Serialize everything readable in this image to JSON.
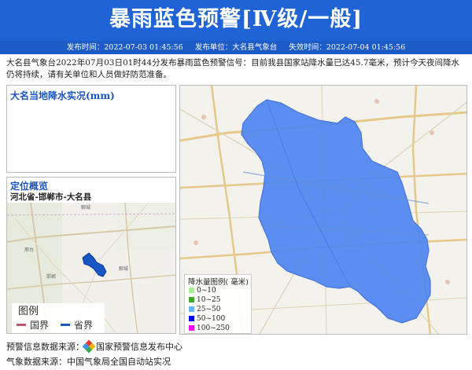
{
  "header": {
    "title": "暴雨蓝色预警[Ⅳ级/一般]",
    "publish_time": "发布时间：2022-07-03 01:45:56",
    "publisher": "发布单位：大名县气象台",
    "expire_time": "失效时间：2022-07-04 01:45:56"
  },
  "description": "大名县气象台2022年07月03日01时44分发布暴雨蓝色预警信号：目前我县国家站降水量已达45.7毫米，预计今天夜间降水仍将持续，请有关单位和人员做好防范准备。",
  "rain_panel": {
    "title": "大名当地降水实况(mm)"
  },
  "location_panel": {
    "title": "定位概览",
    "path": "河北省-邯郸市-大名县",
    "legend_title": "图例",
    "legend_items": [
      {
        "label": "国界",
        "color": "#c4506a"
      },
      {
        "label": "省界",
        "color": "#1a55c4"
      }
    ]
  },
  "main_map": {
    "legend_title": "降水量图例( 毫米)",
    "legend_items": [
      {
        "label": "0~10",
        "color": "#a6f28f"
      },
      {
        "label": "10~25",
        "color": "#3da82b"
      },
      {
        "label": "25~50",
        "color": "#61b8ff"
      },
      {
        "label": "50~100",
        "color": "#0000fe"
      },
      {
        "label": "100~250",
        "color": "#fa00fa"
      }
    ],
    "region_color": "#4f86f0"
  },
  "footer": {
    "source1": "预警信息数据来源：",
    "source1_org": "国家预警信息发布中心",
    "source2": "气象数据来源：中国气象局全国自动站实况"
  }
}
